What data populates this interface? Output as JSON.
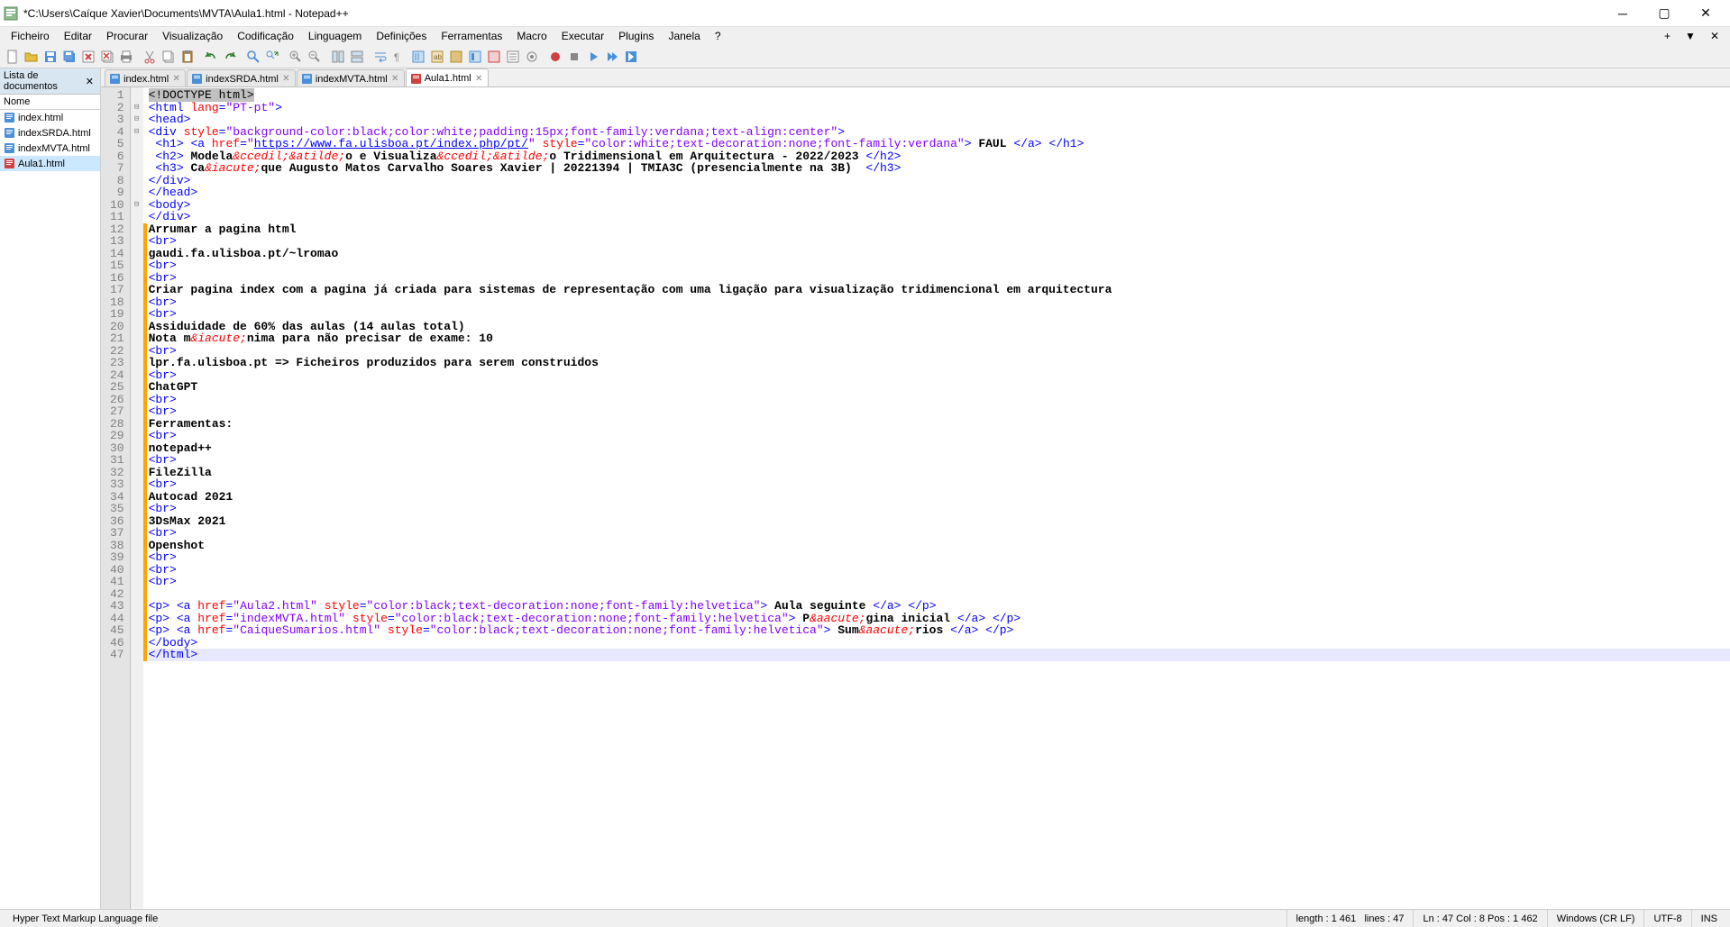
{
  "title": "*C:\\Users\\Caíque Xavier\\Documents\\MVTA\\Aula1.html - Notepad++",
  "menu": [
    "Ficheiro",
    "Editar",
    "Procurar",
    "Visualização",
    "Codificação",
    "Linguagem",
    "Definições",
    "Ferramentas",
    "Macro",
    "Executar",
    "Plugins",
    "Janela",
    "?"
  ],
  "doclist": {
    "title": "Lista de documentos",
    "colhead": "Nome",
    "items": [
      "index.html",
      "indexSRDA.html",
      "indexMVTA.html",
      "Aula1.html"
    ],
    "selected": 3
  },
  "tabs": [
    {
      "label": "index.html",
      "dirty": false,
      "active": false
    },
    {
      "label": "indexSRDA.html",
      "dirty": false,
      "active": false
    },
    {
      "label": "indexMVTA.html",
      "dirty": false,
      "active": false
    },
    {
      "label": "Aula1.html",
      "dirty": true,
      "active": true
    }
  ],
  "code": {
    "total_lines": 47,
    "current_line": 47
  },
  "status": {
    "lang": "Hyper Text Markup Language file",
    "length": "length : 1 461",
    "lines": "lines : 47",
    "pos": "Ln : 47   Col : 8   Pos : 1 462",
    "eol": "Windows (CR LF)",
    "enc": "UTF-8",
    "ins": "INS"
  }
}
